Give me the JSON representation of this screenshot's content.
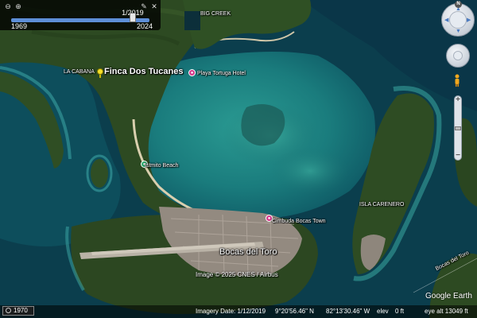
{
  "app": {
    "name": "Google Earth"
  },
  "time_slider": {
    "current_date": "1/2019",
    "start_year": "1969",
    "end_year": "2024",
    "position_fraction": 0.88,
    "tools": [
      "search-zoom-out-icon",
      "zoom-in-icon",
      "wrench-icon",
      "close-icon"
    ]
  },
  "map_labels": {
    "big_creek": "BIG CREEK",
    "la_cabana": "LA CABANA",
    "finca": "Finca Dos Tucanes",
    "playa_tortuga": "Playa Tortuga Hotel",
    "istmito": "Istmito Beach",
    "isla_carenero": "ISLA CARENERO",
    "bocas_town": "Bocas del Toro",
    "bocas_del_toro_channel": "Bocas del Toro",
    "cimbuda": "Cimbuda Bocas Town"
  },
  "credit": "Image © 2025 CNES / Airbus",
  "logo": "Google Earth",
  "status_bar": {
    "year_button": "1970",
    "imagery_date": "Imagery Date: 1/12/2019",
    "latitude": "9°20'56.46\" N",
    "longitude": "82°13'30.46\" W",
    "elev_label": "elev",
    "elev_value": "0 ft",
    "eye_alt": "eye alt  13049 ft"
  },
  "nav": {
    "north": "N",
    "zoom_in": "+",
    "zoom_out": "−",
    "zoom_fraction": 0.5
  },
  "colors": {
    "ocean_deep": "#0a3a4a",
    "lagoon": "#1f8d8a",
    "land": "#2f4a22",
    "town": "#9a8f86",
    "accent_pin": "#d63a8c",
    "slider_track": "#5e8fd8"
  }
}
